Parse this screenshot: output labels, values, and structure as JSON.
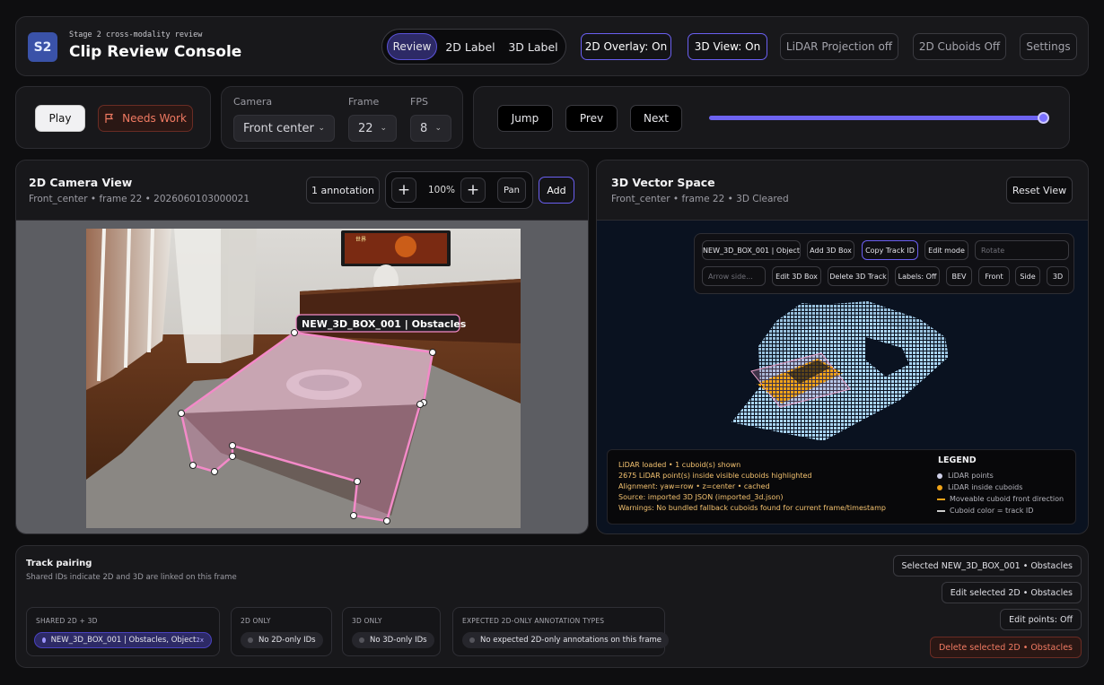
{
  "header": {
    "logo": "S2",
    "eyebrow": "Stage 2 cross-modality review",
    "title": "Clip Review Console",
    "tabs": [
      "Review",
      "2D Label",
      "3D Label"
    ],
    "toggles": [
      "2D Overlay: On",
      "3D View: On",
      "LiDAR Projection off",
      "2D Cuboids Off"
    ],
    "settings": "Settings"
  },
  "playback": {
    "play": "Play",
    "needs_work": "Needs Work",
    "camera_label": "Camera",
    "camera_value": "Front center",
    "frame_label": "Frame",
    "frame_value": "22",
    "fps_label": "FPS",
    "fps_value": "8",
    "jump": "Jump",
    "prev": "Prev",
    "next": "Next",
    "scrub_position": 1.0
  },
  "camera_view": {
    "title": "2D Camera View",
    "subtitle": "Front_center • frame 22 • 2026060103000021",
    "annotation_count": "1 annotation",
    "zoom": "100%",
    "pan": "Pan",
    "add": "Add",
    "box_label": "NEW_3D_BOX_001 | Obstacles",
    "tv_text": "世界"
  },
  "vector_space": {
    "title": "3D Vector Space",
    "subtitle": "Front_center • frame 22 • 3D Cleared",
    "reset": "Reset View",
    "toolbar_row1": [
      "NEW_3D_BOX_001 | Object",
      "Add 3D Box",
      "Copy Track ID",
      "Edit mode"
    ],
    "rotate_placeholder": "Rotate",
    "arrow_placeholder": "Arrow side...",
    "toolbar_row2": [
      "Edit 3D Box",
      "Delete 3D Track",
      "Labels: Off",
      "BEV",
      "Front",
      "Side",
      "3D"
    ],
    "status_lines": [
      "LiDAR loaded • 1 cuboid(s) shown",
      "2675 LiDAR point(s) inside visible cuboids highlighted",
      "Alignment: yaw=row • z=center • cached",
      "Source: imported 3D JSON (imported_3d.json)",
      "Warnings: No bundled fallback cuboids found for current frame/timestamp"
    ],
    "legend_title": "LEGEND",
    "legend": [
      "LiDAR points",
      "LiDAR inside cuboids",
      "Moveable cuboid front direction",
      "Cuboid color = track ID"
    ],
    "colors": {
      "lidar": "#a9d4f2",
      "inside": "#f0a318",
      "accent": "#6a5ff0"
    }
  },
  "track_pairing": {
    "title": "Track pairing",
    "subtitle": "Shared IDs indicate 2D and 3D are linked on this frame",
    "shared_title": "SHARED 2D + 3D",
    "shared_chip": "NEW_3D_BOX_001 | Obstacles, Object",
    "shared_chip_suffix": "2x",
    "only2d_title": "2D ONLY",
    "only2d_chip": "No 2D-only IDs",
    "only3d_title": "3D ONLY",
    "only3d_chip": "No 3D-only IDs",
    "expected_title": "EXPECTED 2D-ONLY ANNOTATION TYPES",
    "expected_chip": "No expected 2D-only annotations on this frame",
    "actions": [
      "Selected NEW_3D_BOX_001 • Obstacles",
      "Edit selected 2D • Obstacles",
      "Edit points: Off",
      "Delete selected 2D • Obstacles"
    ]
  }
}
